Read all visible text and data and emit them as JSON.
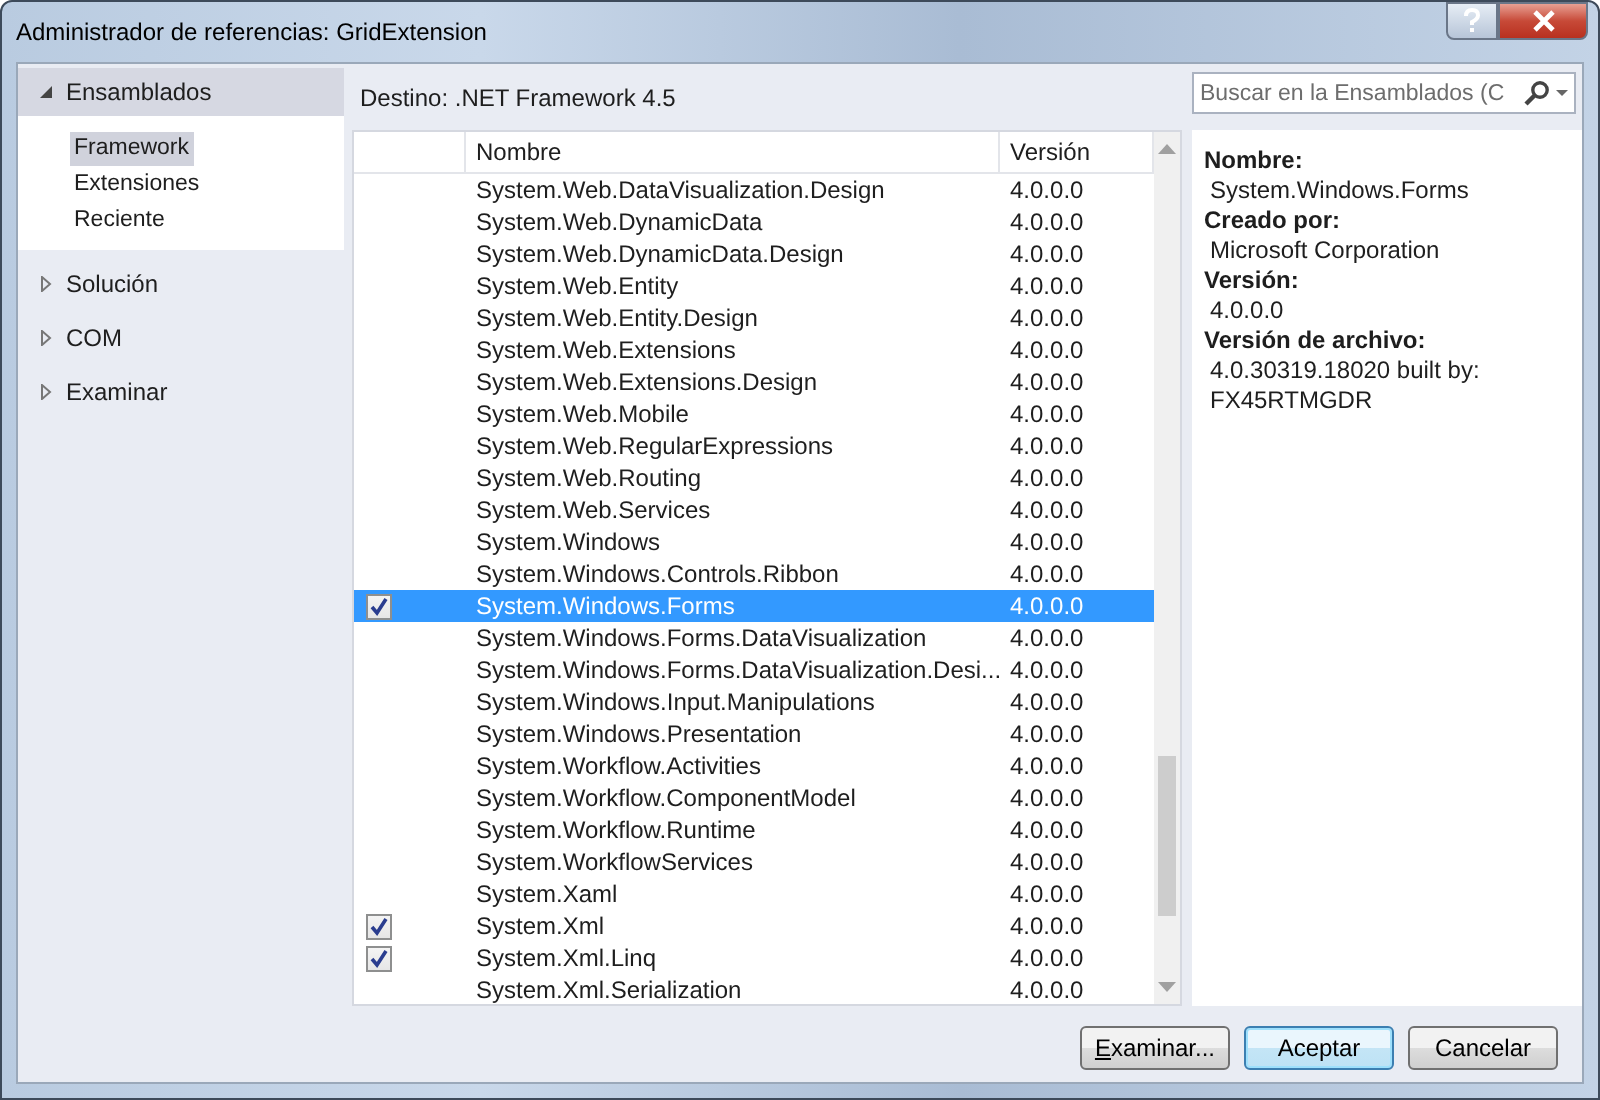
{
  "window": {
    "title": "Administrador de referencias: GridExtension"
  },
  "sidebar": {
    "sections": [
      {
        "label": "Ensamblados",
        "expanded": true,
        "children": [
          {
            "label": "Framework",
            "selected": true
          },
          {
            "label": "Extensiones",
            "selected": false
          },
          {
            "label": "Reciente",
            "selected": false
          }
        ]
      },
      {
        "label": "Solución",
        "expanded": false
      },
      {
        "label": "COM",
        "expanded": false
      },
      {
        "label": "Examinar",
        "expanded": false
      }
    ]
  },
  "target": "Destino: .NET Framework 4.5",
  "search": {
    "placeholder": "Buscar en la Ensamblados (C"
  },
  "table": {
    "columns": [
      "Nombre",
      "Versión"
    ],
    "rows": [
      {
        "checked": false,
        "selected": false,
        "name": "System.Web.DataVisualization.Design",
        "version": "4.0.0.0"
      },
      {
        "checked": false,
        "selected": false,
        "name": "System.Web.DynamicData",
        "version": "4.0.0.0"
      },
      {
        "checked": false,
        "selected": false,
        "name": "System.Web.DynamicData.Design",
        "version": "4.0.0.0"
      },
      {
        "checked": false,
        "selected": false,
        "name": "System.Web.Entity",
        "version": "4.0.0.0"
      },
      {
        "checked": false,
        "selected": false,
        "name": "System.Web.Entity.Design",
        "version": "4.0.0.0"
      },
      {
        "checked": false,
        "selected": false,
        "name": "System.Web.Extensions",
        "version": "4.0.0.0"
      },
      {
        "checked": false,
        "selected": false,
        "name": "System.Web.Extensions.Design",
        "version": "4.0.0.0"
      },
      {
        "checked": false,
        "selected": false,
        "name": "System.Web.Mobile",
        "version": "4.0.0.0"
      },
      {
        "checked": false,
        "selected": false,
        "name": "System.Web.RegularExpressions",
        "version": "4.0.0.0"
      },
      {
        "checked": false,
        "selected": false,
        "name": "System.Web.Routing",
        "version": "4.0.0.0"
      },
      {
        "checked": false,
        "selected": false,
        "name": "System.Web.Services",
        "version": "4.0.0.0"
      },
      {
        "checked": false,
        "selected": false,
        "name": "System.Windows",
        "version": "4.0.0.0"
      },
      {
        "checked": false,
        "selected": false,
        "name": "System.Windows.Controls.Ribbon",
        "version": "4.0.0.0"
      },
      {
        "checked": true,
        "selected": true,
        "name": "System.Windows.Forms",
        "version": "4.0.0.0"
      },
      {
        "checked": false,
        "selected": false,
        "name": "System.Windows.Forms.DataVisualization",
        "version": "4.0.0.0"
      },
      {
        "checked": false,
        "selected": false,
        "name": "System.Windows.Forms.DataVisualization.Desi...",
        "version": "4.0.0.0"
      },
      {
        "checked": false,
        "selected": false,
        "name": "System.Windows.Input.Manipulations",
        "version": "4.0.0.0"
      },
      {
        "checked": false,
        "selected": false,
        "name": "System.Windows.Presentation",
        "version": "4.0.0.0"
      },
      {
        "checked": false,
        "selected": false,
        "name": "System.Workflow.Activities",
        "version": "4.0.0.0"
      },
      {
        "checked": false,
        "selected": false,
        "name": "System.Workflow.ComponentModel",
        "version": "4.0.0.0"
      },
      {
        "checked": false,
        "selected": false,
        "name": "System.Workflow.Runtime",
        "version": "4.0.0.0"
      },
      {
        "checked": false,
        "selected": false,
        "name": "System.WorkflowServices",
        "version": "4.0.0.0"
      },
      {
        "checked": false,
        "selected": false,
        "name": "System.Xaml",
        "version": "4.0.0.0"
      },
      {
        "checked": true,
        "selected": false,
        "name": "System.Xml",
        "version": "4.0.0.0"
      },
      {
        "checked": true,
        "selected": false,
        "name": "System.Xml.Linq",
        "version": "4.0.0.0"
      },
      {
        "checked": false,
        "selected": false,
        "name": "System.Xml.Serialization",
        "version": "4.0.0.0"
      }
    ]
  },
  "details": [
    {
      "label": "Nombre:",
      "value": "System.Windows.Forms"
    },
    {
      "label": "Creado por:",
      "value": "Microsoft Corporation"
    },
    {
      "label": "Versión:",
      "value": "4.0.0.0"
    },
    {
      "label": "Versión de archivo:",
      "value": "4.0.30319.18020 built by: FX45RTMGDR"
    }
  ],
  "buttons": [
    {
      "label": "Examinar...",
      "default": false
    },
    {
      "label": "Aceptar",
      "default": true
    },
    {
      "label": "Cancelar",
      "default": false
    }
  ]
}
